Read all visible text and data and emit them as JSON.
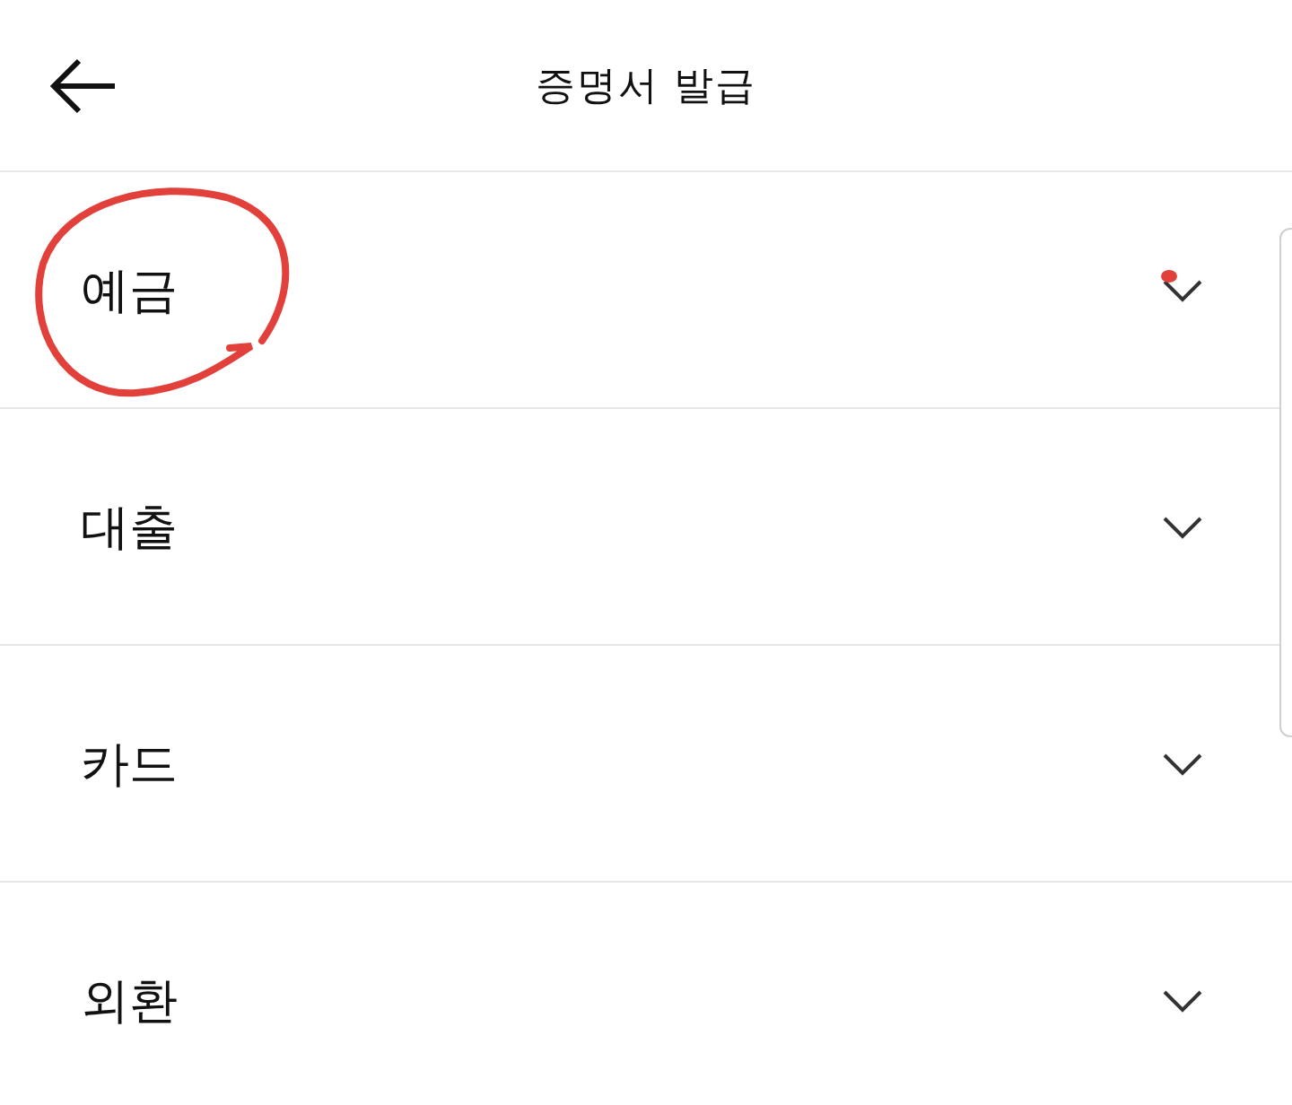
{
  "header": {
    "title": "증명서 발급"
  },
  "menu": [
    {
      "label": "예금",
      "expanded": false,
      "circled": true
    },
    {
      "label": "대출",
      "expanded": false,
      "circled": false
    },
    {
      "label": "카드",
      "expanded": false,
      "circled": false
    },
    {
      "label": "외환",
      "expanded": false,
      "circled": false
    }
  ]
}
